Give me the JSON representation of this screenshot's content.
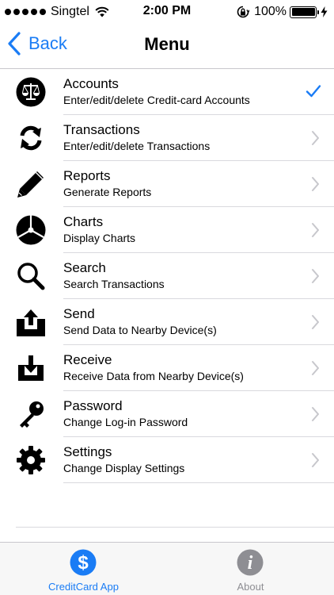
{
  "status_bar": {
    "carrier": "Singtel",
    "time": "2:00 PM",
    "battery": "100%"
  },
  "nav": {
    "back_label": "Back",
    "title": "Menu"
  },
  "menu": {
    "items": [
      {
        "title": "Accounts",
        "subtitle": "Enter/edit/delete Credit-card Accounts",
        "icon": "scales-icon",
        "accessory": "checkmark"
      },
      {
        "title": "Transactions",
        "subtitle": "Enter/edit/delete Transactions",
        "icon": "refresh-icon",
        "accessory": "chevron"
      },
      {
        "title": "Reports",
        "subtitle": "Generate Reports",
        "icon": "pencil-icon",
        "accessory": "chevron"
      },
      {
        "title": "Charts",
        "subtitle": "Display Charts",
        "icon": "pie-chart-icon",
        "accessory": "chevron"
      },
      {
        "title": "Search",
        "subtitle": "Search Transactions",
        "icon": "magnifier-icon",
        "accessory": "chevron"
      },
      {
        "title": "Send",
        "subtitle": "Send Data to Nearby Device(s)",
        "icon": "upload-icon",
        "accessory": "chevron"
      },
      {
        "title": "Receive",
        "subtitle": "Receive Data from Nearby Device(s)",
        "icon": "download-icon",
        "accessory": "chevron"
      },
      {
        "title": "Password",
        "subtitle": "Change Log-in Password",
        "icon": "key-icon",
        "accessory": "chevron"
      },
      {
        "title": "Settings",
        "subtitle": "Change Display Settings",
        "icon": "gear-icon",
        "accessory": "chevron"
      }
    ]
  },
  "tab_bar": {
    "tabs": [
      {
        "label": "CreditCard App",
        "icon": "dollar-icon",
        "active": true
      },
      {
        "label": "About",
        "icon": "info-icon",
        "active": false
      }
    ]
  },
  "colors": {
    "accent": "#1a7cf5",
    "inactive": "#8e8e93"
  }
}
